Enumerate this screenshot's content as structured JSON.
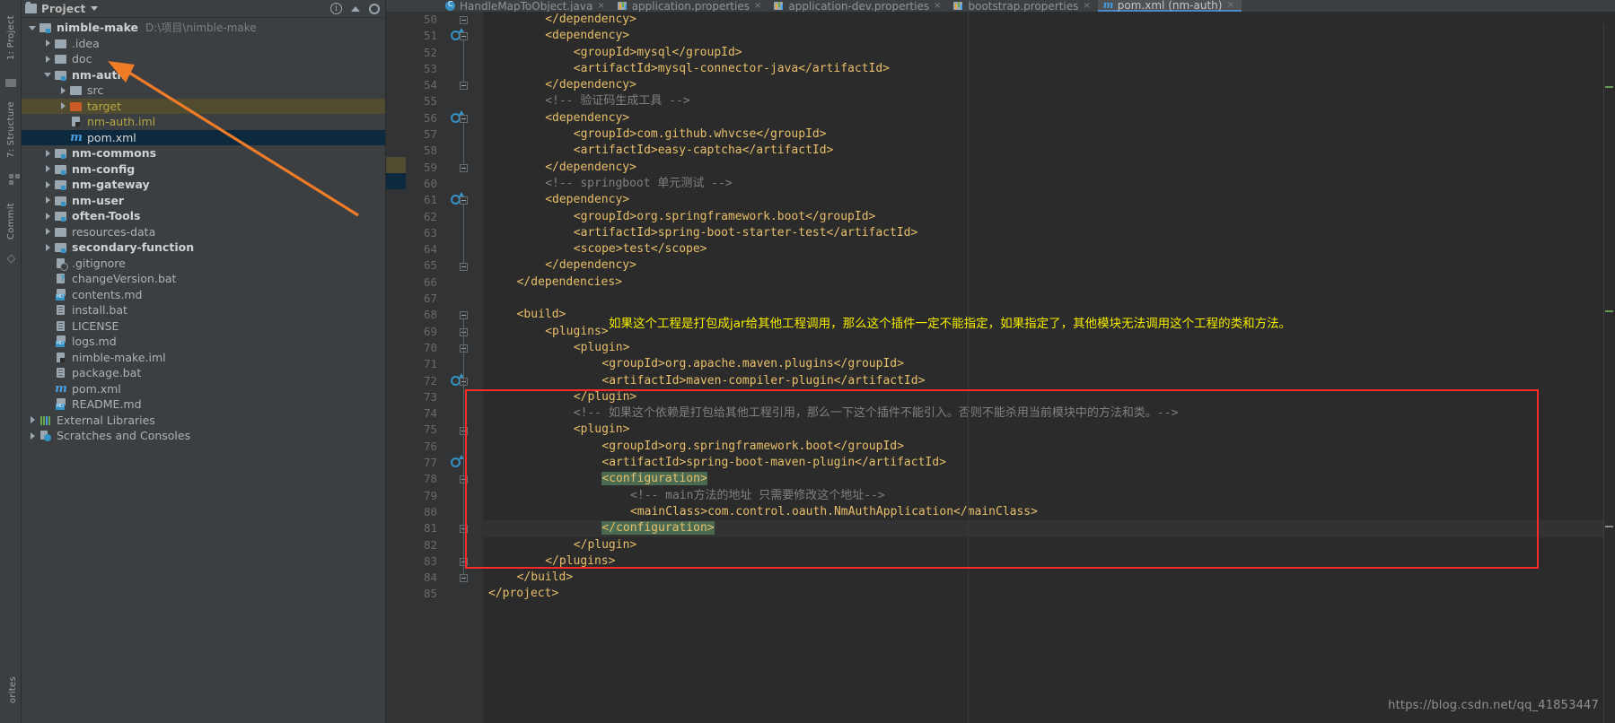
{
  "window": {
    "theme_bg": "#3c3f41",
    "editor_bg": "#2b2b2b",
    "accent_blue": "#3592c4",
    "annotation_yellow": "#f5ec00",
    "annotation_red": "#ff2a2a",
    "arrow_orange": "#f07c28"
  },
  "tool_strip": {
    "items": [
      {
        "label": "1: Project",
        "name": "tool-project"
      },
      {
        "label": "7: Structure",
        "name": "tool-structure"
      },
      {
        "label": "Commit",
        "name": "tool-commit"
      },
      {
        "label": "orites",
        "name": "tool-favorites"
      }
    ]
  },
  "project_panel": {
    "header": {
      "title": "Project",
      "icons": [
        "folder-icon",
        "chevron-down-icon",
        "info-icon",
        "collapse-icon",
        "gear-icon"
      ]
    },
    "tree": [
      {
        "indent": 0,
        "arrow": "down",
        "icon": "module-folder-icon",
        "label": "nimble-make",
        "style": "bold",
        "path": "D:\\项目\\nimble-make",
        "row": "normal"
      },
      {
        "indent": 1,
        "arrow": "right",
        "icon": "folder-icon",
        "label": ".idea",
        "style": "norm",
        "path": "",
        "row": "normal"
      },
      {
        "indent": 1,
        "arrow": "right",
        "icon": "folder-icon",
        "label": "doc",
        "style": "norm",
        "path": "",
        "row": "normal"
      },
      {
        "indent": 1,
        "arrow": "down",
        "icon": "module-folder-icon",
        "label": "nm-auth",
        "style": "bold",
        "path": "",
        "row": "normal"
      },
      {
        "indent": 2,
        "arrow": "right",
        "icon": "folder-icon",
        "label": "src",
        "style": "norm",
        "path": "",
        "row": "normal"
      },
      {
        "indent": 2,
        "arrow": "right",
        "icon": "folder-orange-icon",
        "label": "target",
        "style": "olive",
        "path": "",
        "row": "sel-olive"
      },
      {
        "indent": 2,
        "arrow": "none",
        "icon": "iml-file-icon",
        "label": "nm-auth.iml",
        "style": "olive",
        "path": "",
        "row": "normal"
      },
      {
        "indent": 2,
        "arrow": "none",
        "icon": "maven-icon",
        "label": "pom.xml",
        "style": "white",
        "path": "",
        "row": "sel-blue"
      },
      {
        "indent": 1,
        "arrow": "right",
        "icon": "module-folder-icon",
        "label": "nm-commons",
        "style": "bold",
        "path": "",
        "row": "normal"
      },
      {
        "indent": 1,
        "arrow": "right",
        "icon": "module-folder-icon",
        "label": "nm-config",
        "style": "bold",
        "path": "",
        "row": "normal"
      },
      {
        "indent": 1,
        "arrow": "right",
        "icon": "module-folder-icon",
        "label": "nm-gateway",
        "style": "bold",
        "path": "",
        "row": "normal"
      },
      {
        "indent": 1,
        "arrow": "right",
        "icon": "module-folder-icon",
        "label": "nm-user",
        "style": "bold",
        "path": "",
        "row": "normal"
      },
      {
        "indent": 1,
        "arrow": "right",
        "icon": "module-folder-icon",
        "label": "often-Tools",
        "style": "bold",
        "path": "",
        "row": "normal"
      },
      {
        "indent": 1,
        "arrow": "right",
        "icon": "folder-icon",
        "label": "resources-data",
        "style": "norm",
        "path": "",
        "row": "normal"
      },
      {
        "indent": 1,
        "arrow": "right",
        "icon": "module-folder-icon",
        "label": "secondary-function",
        "style": "bold",
        "path": "",
        "row": "normal"
      },
      {
        "indent": 1,
        "arrow": "none",
        "icon": "gitignore-icon",
        "label": ".gitignore",
        "style": "norm",
        "path": "",
        "row": "normal"
      },
      {
        "indent": 1,
        "arrow": "none",
        "icon": "bat-question-icon",
        "label": "changeVersion.bat",
        "style": "norm",
        "path": "",
        "row": "normal"
      },
      {
        "indent": 1,
        "arrow": "none",
        "icon": "markdown-icon",
        "label": "contents.md",
        "style": "norm",
        "path": "",
        "row": "normal"
      },
      {
        "indent": 1,
        "arrow": "none",
        "icon": "file-icon",
        "label": "install.bat",
        "style": "norm",
        "path": "",
        "row": "normal"
      },
      {
        "indent": 1,
        "arrow": "none",
        "icon": "file-icon",
        "label": "LICENSE",
        "style": "norm",
        "path": "",
        "row": "normal"
      },
      {
        "indent": 1,
        "arrow": "none",
        "icon": "markdown-icon",
        "label": "logs.md",
        "style": "norm",
        "path": "",
        "row": "normal"
      },
      {
        "indent": 1,
        "arrow": "none",
        "icon": "iml-file-icon",
        "label": "nimble-make.iml",
        "style": "norm",
        "path": "",
        "row": "normal"
      },
      {
        "indent": 1,
        "arrow": "none",
        "icon": "file-icon",
        "label": "package.bat",
        "style": "norm",
        "path": "",
        "row": "normal"
      },
      {
        "indent": 1,
        "arrow": "none",
        "icon": "maven-icon",
        "label": "pom.xml",
        "style": "norm",
        "path": "",
        "row": "normal"
      },
      {
        "indent": 1,
        "arrow": "none",
        "icon": "markdown-icon",
        "label": "README.md",
        "style": "norm",
        "path": "",
        "row": "normal"
      },
      {
        "indent": 0,
        "arrow": "right",
        "icon": "external-libraries-icon",
        "label": "External Libraries",
        "style": "norm",
        "path": "",
        "row": "normal"
      },
      {
        "indent": 0,
        "arrow": "right",
        "icon": "scratches-icon",
        "label": "Scratches and Consoles",
        "style": "norm",
        "path": "",
        "row": "normal"
      }
    ]
  },
  "editor": {
    "tabs": [
      {
        "label": "HandleMapToObject.java",
        "icon": "java-class-icon",
        "active": false
      },
      {
        "label": "application.properties",
        "icon": "properties-icon",
        "active": false
      },
      {
        "label": "application-dev.properties",
        "icon": "properties-icon",
        "active": false
      },
      {
        "label": "bootstrap.properties",
        "icon": "properties-icon",
        "active": false
      },
      {
        "label": "pom.xml (nm-auth)",
        "icon": "maven-icon",
        "active": true
      }
    ],
    "first_line_number": 50,
    "lines": [
      {
        "n": 50,
        "indent": 8,
        "text": "</dependency>",
        "kind": "tag"
      },
      {
        "n": 51,
        "indent": 8,
        "text": "<dependency>",
        "kind": "tag"
      },
      {
        "n": 52,
        "indent": 12,
        "text": "<groupId>mysql</groupId>",
        "kind": "mixed"
      },
      {
        "n": 53,
        "indent": 12,
        "text": "<artifactId>mysql-connector-java</artifactId>",
        "kind": "mixed"
      },
      {
        "n": 54,
        "indent": 8,
        "text": "</dependency>",
        "kind": "tag"
      },
      {
        "n": 55,
        "indent": 8,
        "text": "<!-- 验证码生成工具 -->",
        "kind": "cmt"
      },
      {
        "n": 56,
        "indent": 8,
        "text": "<dependency>",
        "kind": "tag"
      },
      {
        "n": 57,
        "indent": 12,
        "text": "<groupId>com.github.whvcse</groupId>",
        "kind": "mixed"
      },
      {
        "n": 58,
        "indent": 12,
        "text": "<artifactId>easy-captcha</artifactId>",
        "kind": "mixed"
      },
      {
        "n": 59,
        "indent": 8,
        "text": "</dependency>",
        "kind": "tag"
      },
      {
        "n": 60,
        "indent": 8,
        "text": "<!-- springboot 单元测试 -->",
        "kind": "cmt"
      },
      {
        "n": 61,
        "indent": 8,
        "text": "<dependency>",
        "kind": "tag"
      },
      {
        "n": 62,
        "indent": 12,
        "text": "<groupId>org.springframework.boot</groupId>",
        "kind": "mixed"
      },
      {
        "n": 63,
        "indent": 12,
        "text": "<artifactId>spring-boot-starter-test</artifactId>",
        "kind": "mixed"
      },
      {
        "n": 64,
        "indent": 12,
        "text": "<scope>test</scope>",
        "kind": "mixed"
      },
      {
        "n": 65,
        "indent": 8,
        "text": "</dependency>",
        "kind": "tag"
      },
      {
        "n": 66,
        "indent": 4,
        "text": "</dependencies>",
        "kind": "tag"
      },
      {
        "n": 67,
        "indent": 0,
        "text": "",
        "kind": "tag"
      },
      {
        "n": 68,
        "indent": 4,
        "text": "<build>",
        "kind": "tag"
      },
      {
        "n": 69,
        "indent": 8,
        "text": "<plugins>",
        "kind": "tag"
      },
      {
        "n": 70,
        "indent": 12,
        "text": "<plugin>",
        "kind": "tag"
      },
      {
        "n": 71,
        "indent": 16,
        "text": "<groupId>org.apache.maven.plugins</groupId>",
        "kind": "mixed"
      },
      {
        "n": 72,
        "indent": 16,
        "text": "<artifactId>maven-compiler-plugin</artifactId>",
        "kind": "mixed"
      },
      {
        "n": 73,
        "indent": 12,
        "text": "</plugin>",
        "kind": "tag"
      },
      {
        "n": 74,
        "indent": 12,
        "text": "<!-- 如果这个依赖是打包给其他工程引用，那么一下这个插件不能引入。否则不能杀用当前模块中的方法和类。-->",
        "kind": "cmt"
      },
      {
        "n": 75,
        "indent": 12,
        "text": "<plugin>",
        "kind": "tag"
      },
      {
        "n": 76,
        "indent": 16,
        "text": "<groupId>org.springframework.boot</groupId>",
        "kind": "mixed"
      },
      {
        "n": 77,
        "indent": 16,
        "text": "<artifactId>spring-boot-maven-plugin</artifactId>",
        "kind": "mixed"
      },
      {
        "n": 78,
        "indent": 16,
        "text": "<configuration>",
        "kind": "tag-hl-green"
      },
      {
        "n": 79,
        "indent": 20,
        "text": "<!-- main方法的地址 只需要修改这个地址-->",
        "kind": "cmt"
      },
      {
        "n": 80,
        "indent": 20,
        "text": "<mainClass>com.control.oauth.NmAuthApplication</mainClass>",
        "kind": "mixed"
      },
      {
        "n": 81,
        "indent": 16,
        "text": "</configuration>",
        "kind": "tag-hl-green"
      },
      {
        "n": 82,
        "indent": 12,
        "text": "</plugin>",
        "kind": "tag"
      },
      {
        "n": 83,
        "indent": 8,
        "text": "</plugins>",
        "kind": "tag"
      },
      {
        "n": 84,
        "indent": 4,
        "text": "</build>",
        "kind": "tag"
      },
      {
        "n": 85,
        "indent": 0,
        "text": "</project>",
        "kind": "tag"
      }
    ],
    "run_marker_lines": [
      51,
      56,
      61,
      72,
      77
    ],
    "current_line": 81
  },
  "annotations": {
    "yellow_note": "如果这个工程是打包成jar给其他工程调用，那么这个插件一定不能指定，如果指定了，其他模块无法调用这个工程的类和方法。",
    "red_box_label": "highlight-rectangle",
    "orange_arrow_label": "pointer-arrow-to-nm-auth"
  },
  "watermark": {
    "text": "https://blog.csdn.net/qq_41853447"
  }
}
